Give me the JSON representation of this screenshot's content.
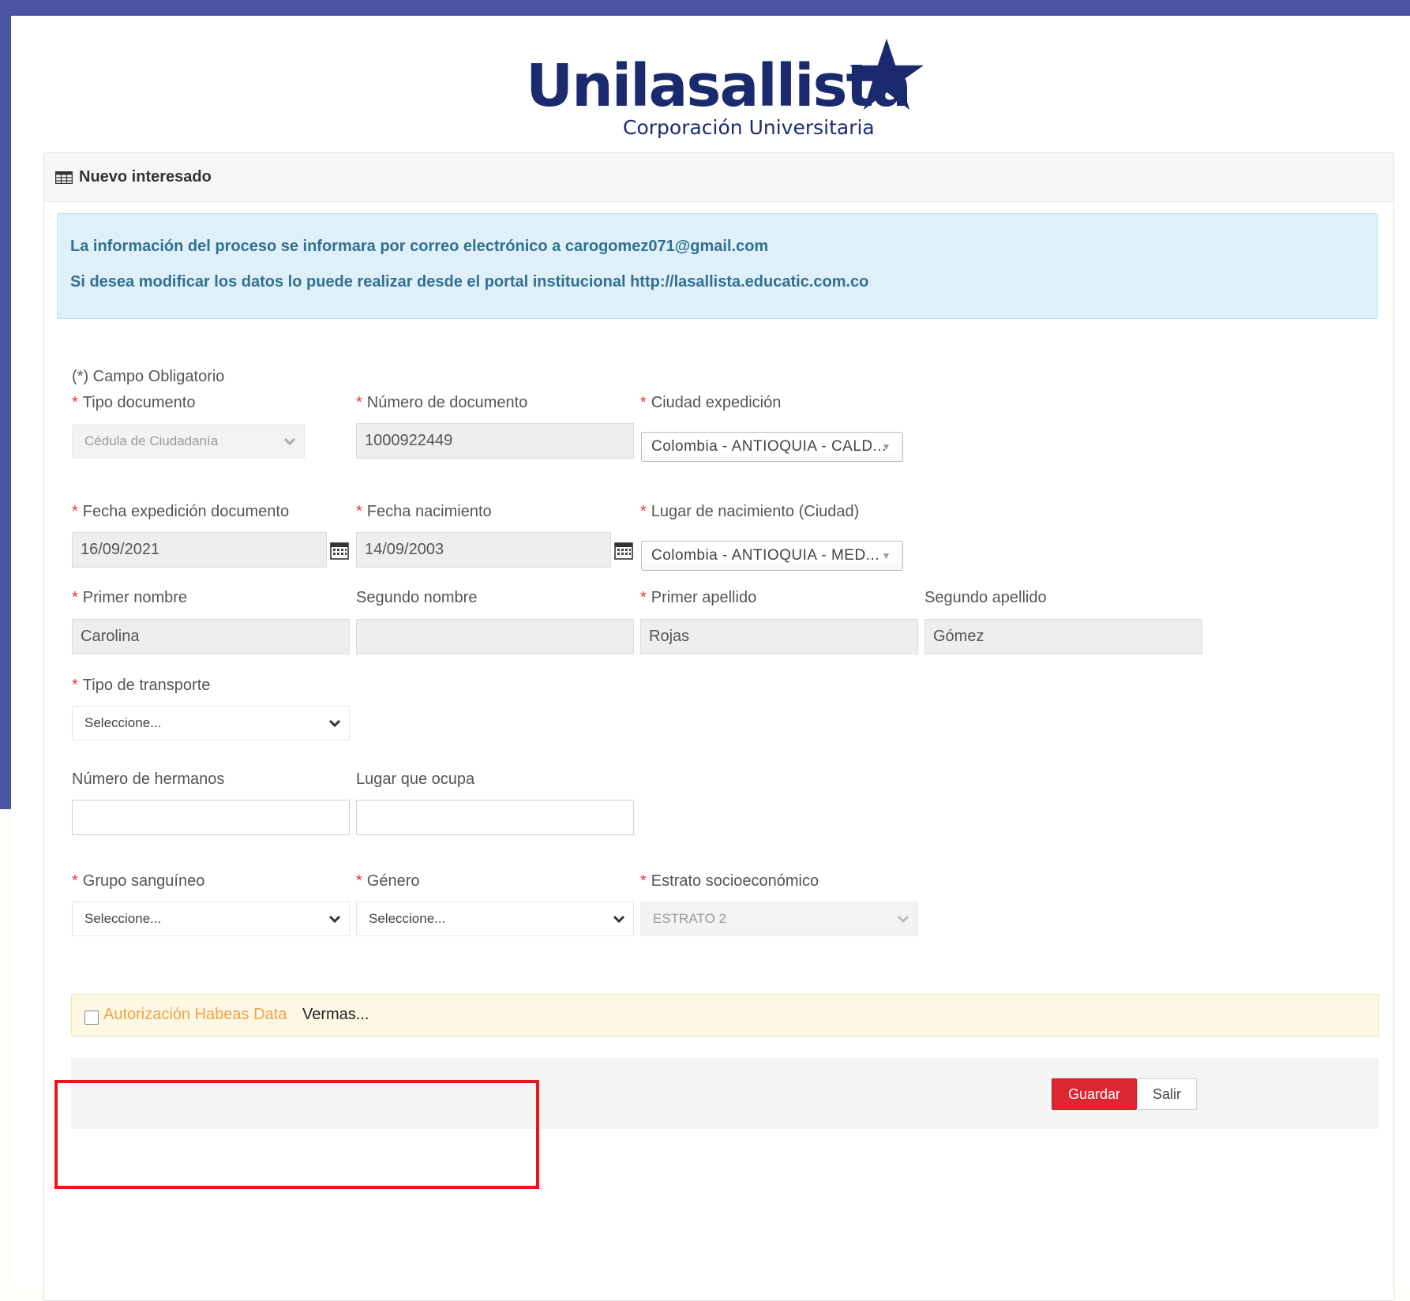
{
  "brand": {
    "name": "Unilasallista",
    "subtitle": "Corporación Universitaria",
    "color": "#1b2a6e"
  },
  "panel": {
    "title": "Nuevo interesado",
    "icon": "table-icon"
  },
  "alert": {
    "line1": "La información del proceso se informara por correo electrónico a carogomez071@gmail.com",
    "line2": "Si desea modificar los datos lo puede realizar desde el portal institucional http://lasallista.educatic.com.co"
  },
  "form": {
    "required_note": "Campo Obligatorio",
    "required_mark": "(*)",
    "asterisk": "*",
    "tipo_documento": {
      "label": "Tipo documento",
      "value": "Cédula de Ciudadanía"
    },
    "numero_documento": {
      "label": "Número de documento",
      "value": "1000922449"
    },
    "ciudad_expedicion": {
      "label": "Ciudad expedición",
      "value": "Colombia - ANTIOQUIA - CALD..."
    },
    "fecha_expedicion": {
      "label": "Fecha expedición documento",
      "value": "16/09/2021"
    },
    "fecha_nacimiento": {
      "label": "Fecha nacimiento",
      "value": "14/09/2003"
    },
    "lugar_nacimiento": {
      "label": "Lugar de nacimiento (Ciudad)",
      "value": "Colombia - ANTIOQUIA - MED..."
    },
    "primer_nombre": {
      "label": "Primer nombre",
      "value": "Carolina"
    },
    "segundo_nombre": {
      "label": "Segundo nombre",
      "value": ""
    },
    "primer_apellido": {
      "label": "Primer apellido",
      "value": "Rojas"
    },
    "segundo_apellido": {
      "label": "Segundo apellido",
      "value": "Gómez"
    },
    "tipo_transporte": {
      "label": "Tipo de transporte",
      "value": "Seleccione..."
    },
    "numero_hermanos": {
      "label": "Número de hermanos",
      "value": ""
    },
    "lugar_ocupa": {
      "label": "Lugar que ocupa",
      "value": ""
    },
    "grupo_sanguineo": {
      "label": "Grupo sanguíneo",
      "value": "Seleccione..."
    },
    "genero": {
      "label": "Género",
      "value": "Seleccione..."
    },
    "estrato": {
      "label": "Estrato socioeconómico",
      "value": "ESTRATO 2"
    }
  },
  "habeas": {
    "label": "Autorización Habeas Data",
    "more": "Vermas..."
  },
  "buttons": {
    "save": "Guardar",
    "exit": "Salir"
  },
  "colors": {
    "frame": "#4b54a3",
    "alert_text": "#31708f",
    "save_button": "#dc2730",
    "highlight_box": "#e8151b"
  }
}
